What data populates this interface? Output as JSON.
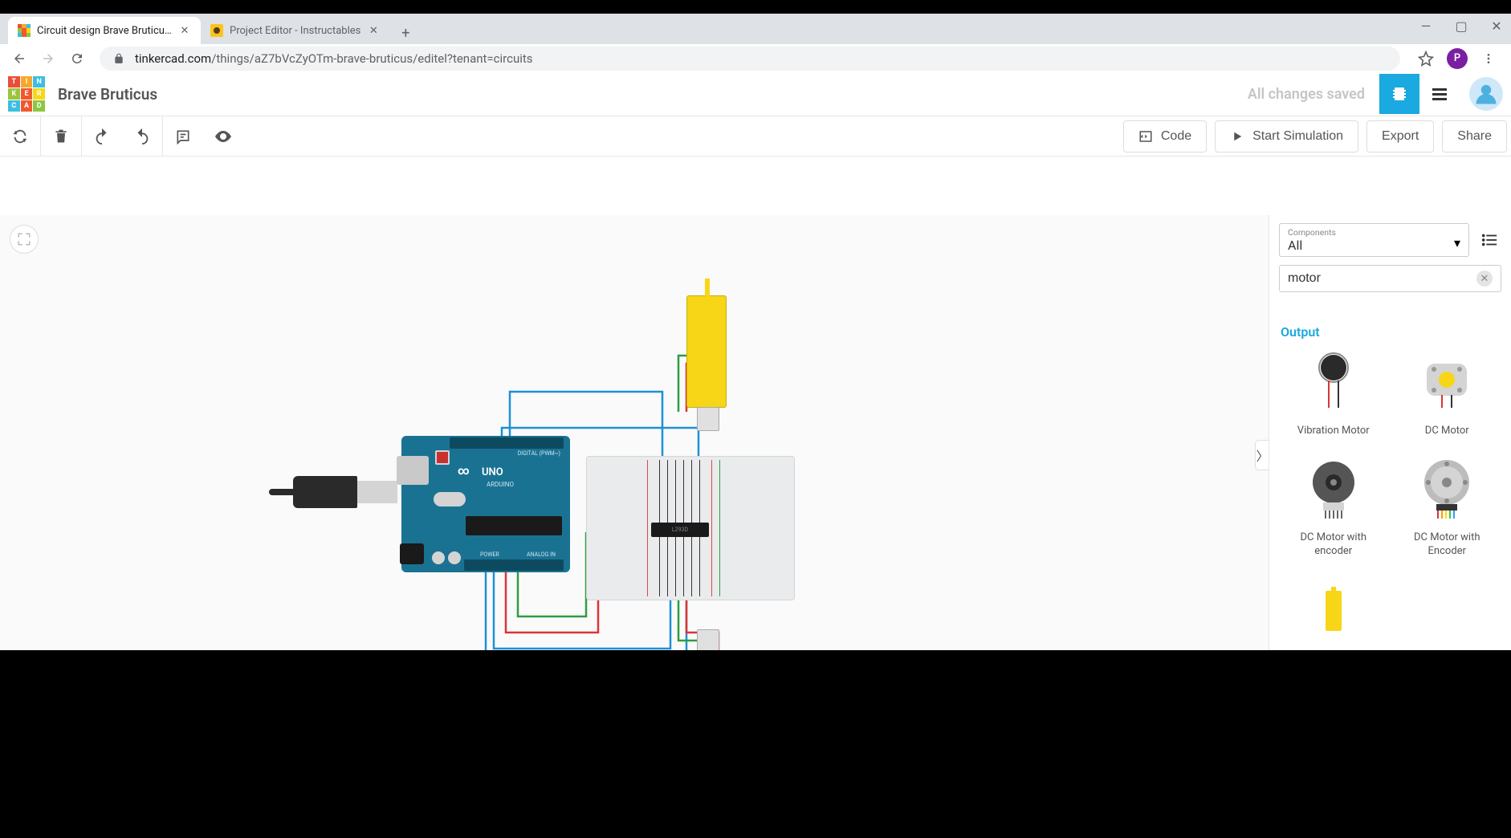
{
  "browser": {
    "tabs": [
      {
        "title": "Circuit design Brave Bruticus | Tin",
        "active": true
      },
      {
        "title": "Project Editor - Instructables",
        "active": false
      }
    ],
    "url_host": "tinkercad.com",
    "url_path": "/things/aZ7bVcZyOTm-brave-bruticus/editel?tenant=circuits",
    "profile_initial": "P"
  },
  "app": {
    "logo_letters": [
      "T",
      "I",
      "N",
      "K",
      "E",
      "R",
      "C",
      "A",
      "D"
    ],
    "logo_colors": [
      "#e94e3a",
      "#f7a82b",
      "#3bbfe0",
      "#9bc53d",
      "#f0592b",
      "#f7d617",
      "#3bbfe0",
      "#f0592b",
      "#8cc63f"
    ],
    "project_title": "Brave Bruticus",
    "save_status": "All changes saved"
  },
  "toolbar": {
    "code_label": "Code",
    "simulate_label": "Start Simulation",
    "export_label": "Export",
    "share_label": "Share"
  },
  "circuit": {
    "arduino_label": "UNO",
    "arduino_sub": "ARDUINO",
    "arduino_top_label": "DIGITAL (PWM~)",
    "arduino_power_label": "POWER",
    "arduino_analog_label": "ANALOG IN",
    "arduino_infinity": "∞",
    "ic_label": "L293D"
  },
  "panel": {
    "dropdown_label": "Components",
    "dropdown_value": "All",
    "search_value": "motor",
    "category": "Output",
    "components": [
      {
        "label": "Vibration Motor"
      },
      {
        "label": "DC Motor"
      },
      {
        "label": "DC Motor with encoder"
      },
      {
        "label": "DC Motor with Encoder"
      }
    ]
  }
}
